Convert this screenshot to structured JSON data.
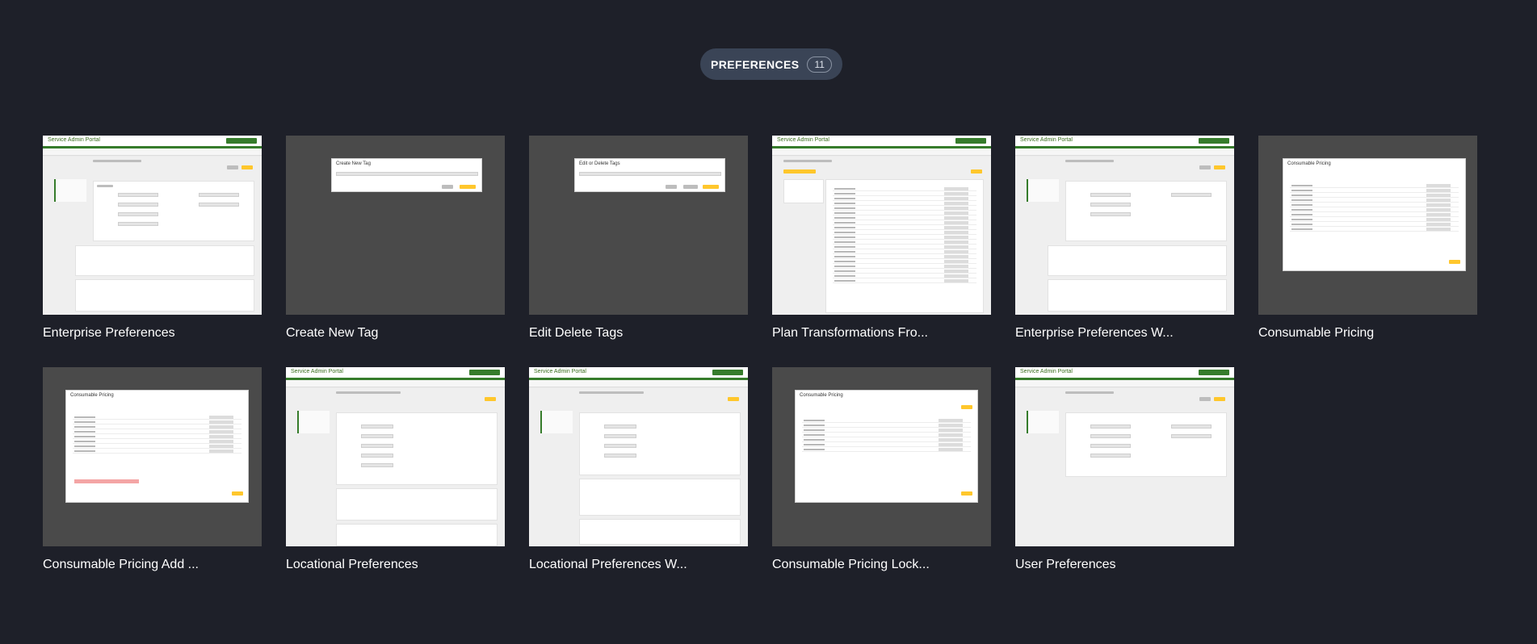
{
  "header": {
    "label": "PREFERENCES",
    "count": "11"
  },
  "cards": [
    {
      "title": "Enterprise Preferences",
      "thumbnail": "enterprise-preferences-screen",
      "portal": "Service Admin Portal"
    },
    {
      "title": "Create New Tag",
      "thumbnail": "create-new-tag-modal",
      "modal_title": "Create New Tag"
    },
    {
      "title": "Edit Delete Tags",
      "thumbnail": "edit-delete-tags-modal",
      "modal_title": "Edit or Delete Tags"
    },
    {
      "title": "Plan Transformations Fro...",
      "thumbnail": "plan-transformations-screen",
      "portal": "Service Admin Portal"
    },
    {
      "title": "Enterprise Preferences W...",
      "thumbnail": "enterprise-preferences-warning-screen",
      "portal": "Service Admin Portal"
    },
    {
      "title": "Consumable Pricing",
      "thumbnail": "consumable-pricing-modal",
      "modal_title": "Consumable Pricing"
    },
    {
      "title": "Consumable Pricing Add ...",
      "thumbnail": "consumable-pricing-add-modal",
      "modal_title": "Consumable Pricing"
    },
    {
      "title": "Locational Preferences",
      "thumbnail": "locational-preferences-screen",
      "portal": "Service Admin Portal"
    },
    {
      "title": "Locational Preferences W...",
      "thumbnail": "locational-preferences-warning-screen",
      "portal": "Service Admin Portal"
    },
    {
      "title": "Consumable Pricing Lock...",
      "thumbnail": "consumable-pricing-locked-modal",
      "modal_title": "Consumable Pricing"
    },
    {
      "title": "User Preferences",
      "thumbnail": "user-preferences-screen",
      "portal": "Service Admin Portal"
    }
  ]
}
